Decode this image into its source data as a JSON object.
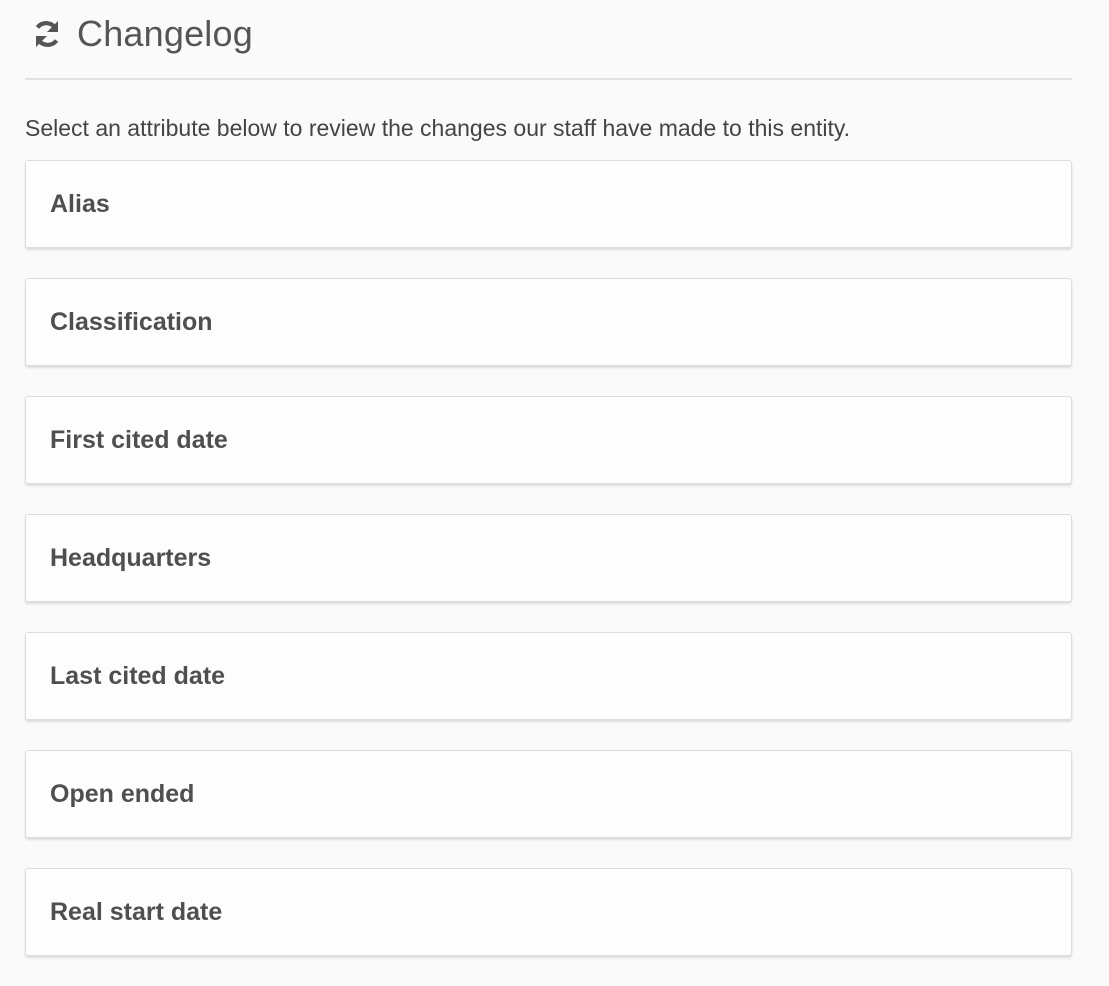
{
  "header": {
    "icon": "refresh-icon",
    "title": "Changelog"
  },
  "intro": "Select an attribute below to review the changes our staff have made to this entity.",
  "attributes": [
    {
      "label": "Alias"
    },
    {
      "label": "Classification"
    },
    {
      "label": "First cited date"
    },
    {
      "label": "Headquarters"
    },
    {
      "label": "Last cited date"
    },
    {
      "label": "Open ended"
    },
    {
      "label": "Real start date"
    }
  ]
}
